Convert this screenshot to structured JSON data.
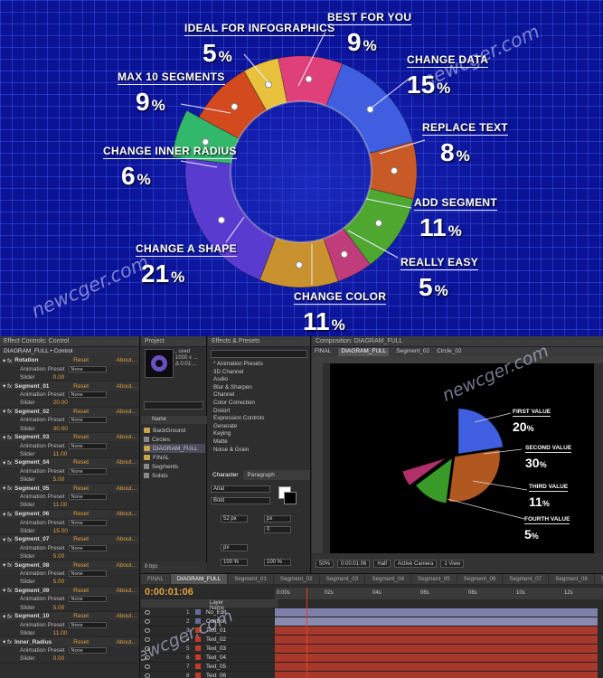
{
  "colors": {
    "bg_blue": "#0a1296",
    "segment_colors": [
      "#5a3bd0",
      "#e8c23c",
      "#e0407a",
      "#3f5fe0",
      "#c85a28",
      "#4ea830",
      "#c03c7a",
      "#c9922e",
      "#7a38c8",
      "#32b86a",
      "#d24a1e"
    ]
  },
  "watermark": "newcger.com",
  "donut": {
    "labels": [
      {
        "name": "IDEAL FOR INFOGRAPHICS",
        "value": "5",
        "unit": "%"
      },
      {
        "name": "BEST FOR YOU",
        "value": "9",
        "unit": "%"
      },
      {
        "name": "MAX 10 SEGMENTS",
        "value": "9",
        "unit": "%"
      },
      {
        "name": "CHANGE DATA",
        "value": "15",
        "unit": "%"
      },
      {
        "name": "REPLACE TEXT",
        "value": "8",
        "unit": "%"
      },
      {
        "name": "CHANGE INNER RADIUS",
        "value": "6",
        "unit": "%"
      },
      {
        "name": "ADD SEGMENT",
        "value": "11",
        "unit": "%"
      },
      {
        "name": "CHANGE A SHAPE",
        "value": "21",
        "unit": "%"
      },
      {
        "name": "REALLY EASY",
        "value": "5",
        "unit": "%"
      },
      {
        "name": "CHANGE COLOR",
        "value": "11",
        "unit": "%"
      }
    ]
  },
  "effect_controls": {
    "title": "Effect Controls: Control",
    "subtitle": "DIAGRAM_FULL • Control",
    "reset": "Reset",
    "about": "About...",
    "preset_label": "Animation Preset",
    "preset_value": "None",
    "slider_label": "Slider",
    "segments": [
      {
        "name": "Rotation",
        "value": "0.00"
      },
      {
        "name": "Segment_01",
        "value": "20.00"
      },
      {
        "name": "Segment_02",
        "value": "30.00"
      },
      {
        "name": "Segment_03",
        "value": "11.00"
      },
      {
        "name": "Segment_04",
        "value": "5.00"
      },
      {
        "name": "Segment_05",
        "value": "11.00"
      },
      {
        "name": "Segment_06",
        "value": "15.00"
      },
      {
        "name": "Segment_07",
        "value": "5.00"
      },
      {
        "name": "Segment_08",
        "value": "5.00"
      },
      {
        "name": "Segment_09",
        "value": "5.00"
      },
      {
        "name": "Segment_10",
        "value": "11.00"
      },
      {
        "name": "Inner_Radius",
        "value": "0.00"
      }
    ]
  },
  "project": {
    "title": "Project",
    "info_used": ", used",
    "info_dims": "1000 x ...",
    "info_time": "Δ 0:01:...",
    "name_header": "Name",
    "items": [
      {
        "name": "BackGround",
        "type": "comp"
      },
      {
        "name": "Circles",
        "type": "folder"
      },
      {
        "name": "DIAGRAM_FULL",
        "type": "comp"
      },
      {
        "name": "FINAL",
        "type": "comp"
      },
      {
        "name": "Segments",
        "type": "folder"
      },
      {
        "name": "Solids",
        "type": "folder"
      }
    ],
    "bpc": "8 bpc"
  },
  "effects_presets": {
    "title": "Effects & Presets",
    "items": [
      "* Animation Presets",
      "3D Channel",
      "Audio",
      "Blur & Sharpen",
      "Channel",
      "Color Correction",
      "Distort",
      "Expression Controls",
      "Generate",
      "Keying",
      "Matte",
      "Noise & Grain"
    ]
  },
  "character": {
    "tab1": "Character",
    "tab2": "Paragraph",
    "font": "Arial",
    "style": "Bold",
    "size": "52 px",
    "leading": "px",
    "tracking": "0",
    "scale_v": "100 %",
    "scale_h": "100 %",
    "baseline": "px"
  },
  "composition": {
    "title": "Composition: DIAGRAM_FULL",
    "tabs": [
      "FINAL",
      "DIAGRAM_FULL",
      "Segment_02",
      "Circle_02"
    ],
    "zoom": "50%",
    "timecode": "0:00:01:06",
    "resolution": "Half",
    "camera": "Active Camera",
    "view": "1 View",
    "mini_labels": [
      {
        "name": "FIRST VALUE",
        "value": "20",
        "unit": "%"
      },
      {
        "name": "SECOND VALUE",
        "value": "30",
        "unit": "%"
      },
      {
        "name": "THIRD VALUE",
        "value": "11",
        "unit": "%"
      },
      {
        "name": "FOURTH VALUE",
        "value": "5",
        "unit": "%"
      }
    ]
  },
  "timeline": {
    "tabs": [
      "FINAL",
      "DIAGRAM_FULL",
      "Segment_01",
      "Segment_02",
      "Segment_03",
      "Segment_04",
      "Segment_05",
      "Segment_06",
      "Segment_07",
      "Segment_08",
      "Se"
    ],
    "timecode": "0:00:01:06",
    "layer_header": "Layer Name",
    "ruler": [
      "0:00s",
      "02s",
      "04s",
      "06s",
      "08s",
      "10s",
      "12s"
    ],
    "layers": [
      {
        "num": "1",
        "name": "No_Edit",
        "color": "#6a6a9a",
        "bar": "#7d80a8"
      },
      {
        "num": "2",
        "name": "Control",
        "color": "#6a6a9a",
        "bar": "#8a8ab0"
      },
      {
        "num": "3",
        "name": "Text_01",
        "color": "#c03c2a",
        "bar": "#a8392a"
      },
      {
        "num": "4",
        "name": "Text_02",
        "color": "#c03c2a",
        "bar": "#a8392a"
      },
      {
        "num": "5",
        "name": "Text_03",
        "color": "#c03c2a",
        "bar": "#a8392a"
      },
      {
        "num": "6",
        "name": "Text_04",
        "color": "#c03c2a",
        "bar": "#a8392a"
      },
      {
        "num": "7",
        "name": "Text_05",
        "color": "#c03c2a",
        "bar": "#a8392a"
      },
      {
        "num": "8",
        "name": "Text_06",
        "color": "#c03c2a",
        "bar": "#a8392a"
      }
    ]
  }
}
